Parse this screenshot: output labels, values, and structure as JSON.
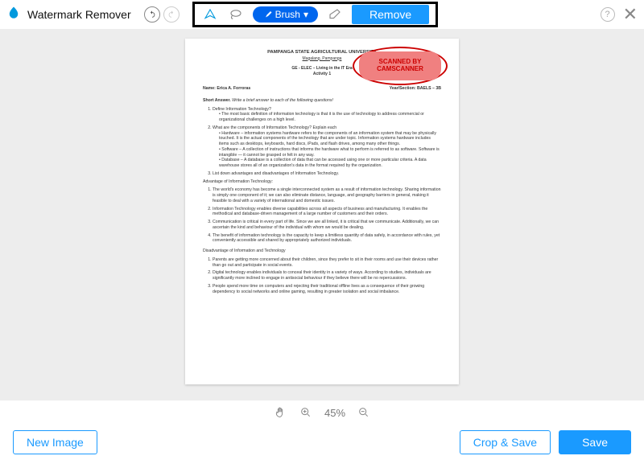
{
  "app": {
    "title": "Watermark Remover"
  },
  "toolbar": {
    "brush_label": "Brush",
    "remove_label": "Remove"
  },
  "watermark": {
    "line1": "SCANNED BY",
    "line2": "CAMSCANNER"
  },
  "document": {
    "university": "PAMPANGA STATE AGRICULTURAL UNIVERSITY",
    "location": "Magalang, Pampanga",
    "course": "GE - ELEC – Living in the IT Era",
    "activity": "Activity 1",
    "name_label": "Name:",
    "name_value": "Erica A. Forroras",
    "section_label": "Year/Section:",
    "section_value": "BAELS – 3B",
    "short_answer_label": "Short Answer.",
    "short_answer_instr": "Write a brief answer to each of the following questions!",
    "q1": "Define Information Technology?",
    "q1_b1": "The most basic definition of information technology is that it is the use of technology to address commercial or organizational challenges on a high level.",
    "q2": "What are the components of Information Technology? Explain each",
    "q2_b1": "Hardware – information systems hardware refers to the components of an information system that may be physically touched. It is the actual components of the technology that are under topic. Information systems hardware includes items such as desktops, keyboards, hard discs, iPads, and flash drives, among many other things.",
    "q2_b2": "Software – A collection of instructions that informs the hardware what to perform is referred to as software. Software is intangible — it cannot be grasped or felt in any way.",
    "q2_b3": "Database – A database is a collection of data that can be accessed using one or more particular criteria. A data warehouse stores all of an organization's data in the format required by the organization.",
    "q3": "List down advantages and disadvantages of Information Technology.",
    "adv_heading": "Advantage of Information Technology:",
    "adv1": "The world's economy has become a single interconnected system as a result of information technology. Sharing information is simply one component of it; we can also eliminate distance, language, and geography barriers in general, making it feasible to deal with a variety of international and domestic issues.",
    "adv2": "Information Technology enables diverse capabilities across all aspects of business and manufacturing. It enables the methodical and database-driven management of a large number of customers and their orders.",
    "adv3": "Communication is critical in every part of life. Since we are all linked, it is critical that we communicate. Additionally, we can ascertain the kind and behaviour of the individual with whom we would be dealing.",
    "adv4": "The benefit of information technology is the capacity to keep a limitless quantity of data safely, in accordance with rules, yet conveniently accessible and shared by appropriately authorized individuals.",
    "dis_heading": "Disadvantage of Information and Technology",
    "dis1": "Parents are getting more concerned about their children, since they prefer to sit in their rooms and use their devices rather than go out and participate in social events.",
    "dis2": "Digital technology enables individuals to conceal their identity in a variety of ways. According to studies, individuals are significantly more inclined to engage in antisocial behaviour if they believe there will be no repercussions.",
    "dis3": "People spend more time on computers and rejecting their traditional offline lives as a consequence of their growing dependency to social networks and online gaming, resulting in greater isolation and social imbalance."
  },
  "zoom": {
    "level": "45%"
  },
  "buttons": {
    "new_image": "New Image",
    "crop_save": "Crop & Save",
    "save": "Save"
  }
}
